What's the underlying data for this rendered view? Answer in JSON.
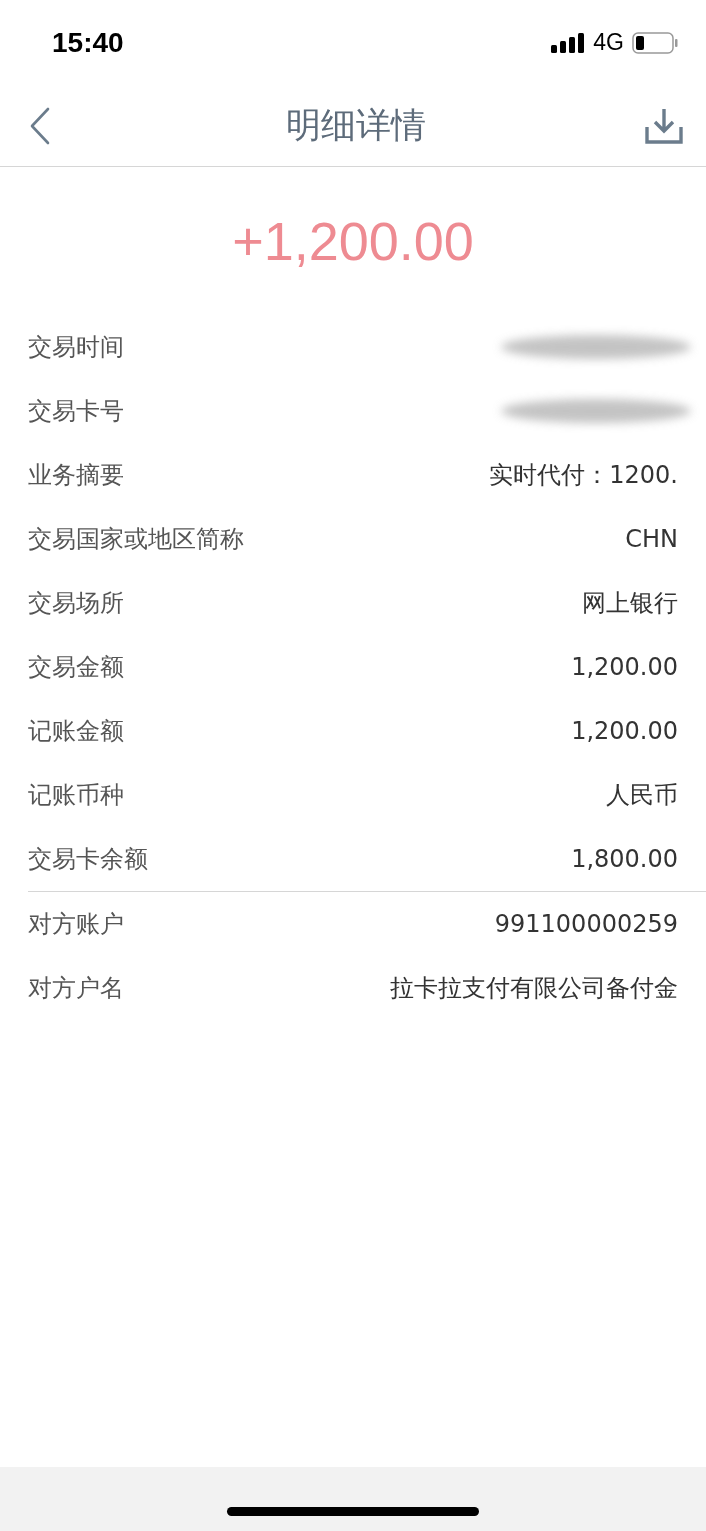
{
  "status_bar": {
    "time": "15:40",
    "network": "4G"
  },
  "nav": {
    "title": "明细详情"
  },
  "amount": "+1,200.00",
  "details": [
    {
      "label": "交易时间",
      "kind": "redacted"
    },
    {
      "label": "交易卡号",
      "kind": "redacted"
    },
    {
      "label": "业务摘要",
      "kind": "text",
      "value": "实时代付：1200."
    },
    {
      "label": "交易国家或地区简称",
      "kind": "text",
      "value": "CHN"
    },
    {
      "label": "交易场所",
      "kind": "text",
      "value": "网上银行"
    },
    {
      "label": "交易金额",
      "kind": "text",
      "value": "1,200.00"
    },
    {
      "label": "记账金额",
      "kind": "text",
      "value": "1,200.00"
    },
    {
      "label": "记账币种",
      "kind": "text",
      "value": "人民币"
    },
    {
      "label": "交易卡余额",
      "kind": "text",
      "value": "1,800.00"
    }
  ],
  "counterparty": [
    {
      "label": "对方账户",
      "kind": "text",
      "value": "991100000259"
    },
    {
      "label": "对方户名",
      "kind": "text",
      "value": "拉卡拉支付有限公司备付金"
    }
  ]
}
